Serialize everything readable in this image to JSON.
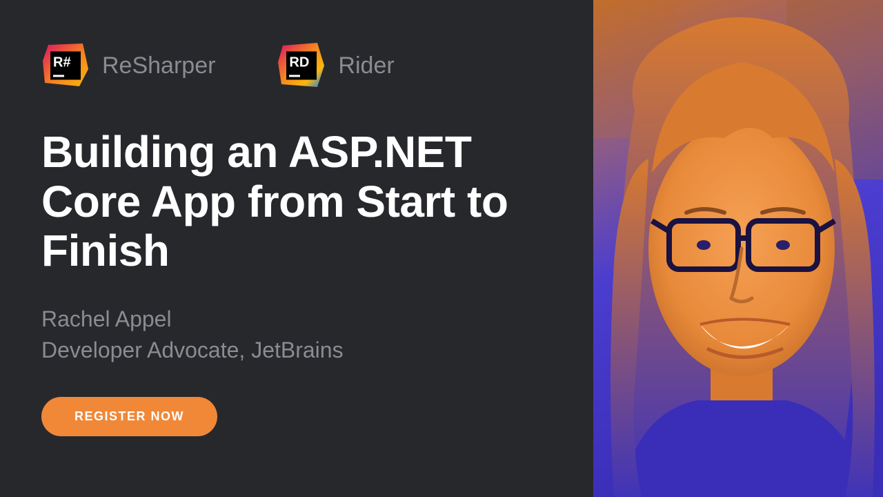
{
  "logos": [
    {
      "name": "ReSharper",
      "badge": "R#",
      "icon": "resharper-icon"
    },
    {
      "name": "Rider",
      "badge": "RD",
      "icon": "rider-icon"
    }
  ],
  "title": "Building an ASP.NET Core App from Start to Finish",
  "speaker": {
    "name": "Rachel Appel",
    "role": "Developer Advocate, JetBrains"
  },
  "cta": {
    "label": "REGISTER NOW"
  },
  "colors": {
    "background": "#27282c",
    "accent": "#f08838",
    "muted": "#8a8c92",
    "portrait_warm": "#e88a3a",
    "portrait_cool": "#4b3dcf"
  }
}
